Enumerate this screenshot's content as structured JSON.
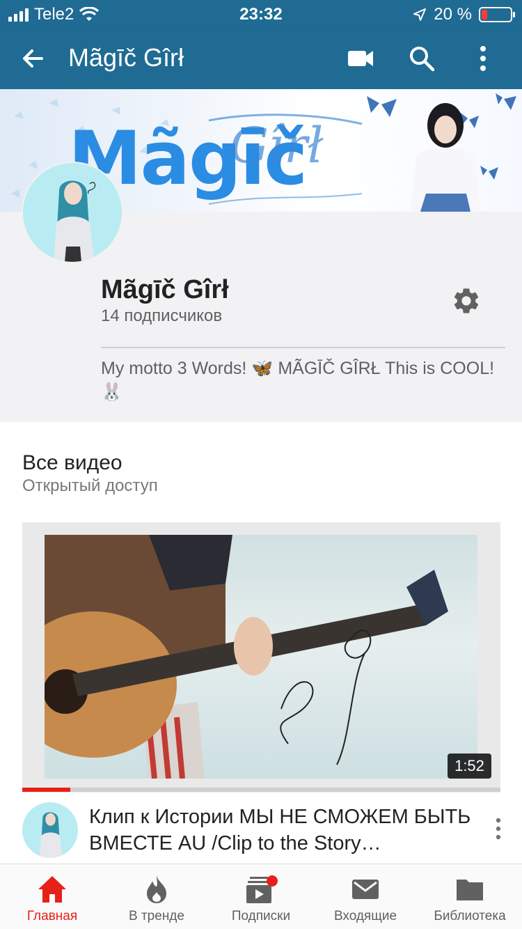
{
  "status_bar": {
    "carrier": "Tele2",
    "time": "23:32",
    "battery_percent": "20 %",
    "battery_level": 0.2
  },
  "app_bar": {
    "title": "Mãgīč Gîrł",
    "icons": [
      "back-arrow-icon",
      "video-camera-icon",
      "search-icon",
      "more-vert-icon"
    ]
  },
  "banner": {
    "logo_text": "Mãgīč",
    "script_text": "Gîrł"
  },
  "channel": {
    "name": "Mãgīč Gîrł",
    "subscribers": "14 подписчиков",
    "description": "My motto 3 Words! 🦋 MÃGĪČ GÎRŁ This is COOL! 🐰"
  },
  "videos_section": {
    "title": "Все видео",
    "subtitle": "Открытый доступ"
  },
  "video": {
    "duration": "1:52",
    "watched_fraction": 0.1,
    "title": "Клип к Истории МЫ НЕ СМОЖЕМ БЫТЬ ВМЕСТЕ AU /Clip to the Story…",
    "meta": ""
  },
  "bottom_nav": {
    "items": [
      {
        "label": "Главная",
        "icon": "home-icon",
        "active": true
      },
      {
        "label": "В тренде",
        "icon": "flame-icon",
        "active": false
      },
      {
        "label": "Подписки",
        "icon": "subscriptions-icon",
        "active": false
      },
      {
        "label": "Входящие",
        "icon": "mail-icon",
        "active": false
      },
      {
        "label": "Библиотека",
        "icon": "folder-icon",
        "active": false
      }
    ]
  },
  "colors": {
    "app_bar": "#1f6b93",
    "accent_red": "#e62117",
    "profile_bg": "#f2f1f3"
  }
}
